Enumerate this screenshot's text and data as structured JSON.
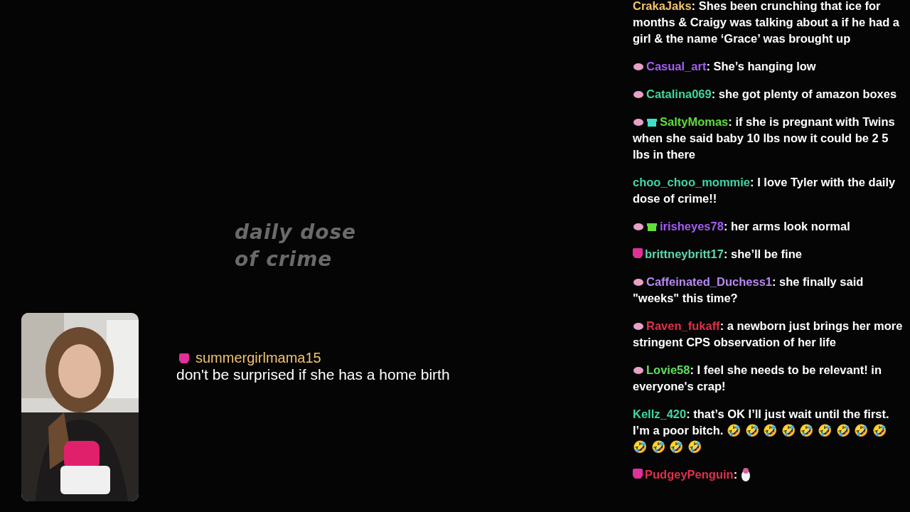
{
  "stream": {
    "logo": [
      "daily dose",
      "of crime"
    ],
    "featured_message": {
      "badges": [
        {
          "kind": "mask",
          "color": "#e0309a"
        }
      ],
      "user": "summergirlmama15",
      "color": "#f2c46d",
      "text": "don't be surprised if she has a home birth"
    }
  },
  "chat": [
    {
      "user": "CrakaJaks",
      "color": "#f2c46d",
      "text": ": Shes been crunching that ice for months & Craigy was talking about a if he had a girl & the name ‘Grace’ was brought up"
    },
    {
      "badges": [
        {
          "kind": "brain",
          "color": "#e8a0c8"
        }
      ],
      "user": "Casual_art",
      "color": "#a35cf5",
      "text": ": She’s hanging low"
    },
    {
      "badges": [
        {
          "kind": "brain",
          "color": "#e8a0c8"
        }
      ],
      "user": "Catalina069",
      "color": "#3fd69a",
      "text": ": she got plenty of amazon boxes"
    },
    {
      "badges": [
        {
          "kind": "brain",
          "color": "#e8a0c8"
        },
        {
          "kind": "gift",
          "color": "#3ee0c4"
        }
      ],
      "user": "SaltyMomas",
      "color": "#5fdc3a",
      "text": ": if she is pregnant with Twins when she said baby 10 lbs now it could be 2 5 lbs in there"
    },
    {
      "user": "choo_choo_mommie",
      "color": "#3fd6a8",
      "text": ": I love Tyler with the daily dose of crime!!"
    },
    {
      "badges": [
        {
          "kind": "brain",
          "color": "#e8a0c8"
        },
        {
          "kind": "gift",
          "color": "#5fe03a"
        }
      ],
      "user": "irisheyes78",
      "color": "#a35cf5",
      "text": ": her arms look normal"
    },
    {
      "badges": [
        {
          "kind": "mask",
          "color": "#e0309a"
        }
      ],
      "user": "brittneybritt17",
      "color": "#5ed6b0",
      "text": ": she’ll be fine"
    },
    {
      "badges": [
        {
          "kind": "brain",
          "color": "#e8a0c8"
        }
      ],
      "user": "Caffeinated_Duchess1",
      "color": "#b58af0",
      "text": ": she finally said \"weeks\" this time?"
    },
    {
      "badges": [
        {
          "kind": "brain",
          "color": "#e8a0c8"
        }
      ],
      "user": "Raven_fukaff",
      "color": "#e0304a",
      "text": ": a newborn just brings her more stringent CPS observation of her life"
    },
    {
      "badges": [
        {
          "kind": "brain",
          "color": "#e8a0c8"
        }
      ],
      "user": "Lovie58",
      "color": "#5fe05a",
      "text": ": I feel she needs to be relevant! in everyone's crap!"
    },
    {
      "user": "Kellz_420",
      "color": "#3fd6a8",
      "text": ": that’s OK I’ll just wait until the first. I’m a poor bitch. 🤣 🤣 🤣 🤣 🤣 🤣 🤣 🤣 🤣 🤣 🤣 🤣 🤣"
    },
    {
      "badges": [
        {
          "kind": "mask",
          "color": "#e0309a"
        }
      ],
      "user": "PudgeyPenguin",
      "color": "#e0304a",
      "text": ":",
      "emotes": [
        {
          "kind": "penguin"
        }
      ]
    }
  ]
}
